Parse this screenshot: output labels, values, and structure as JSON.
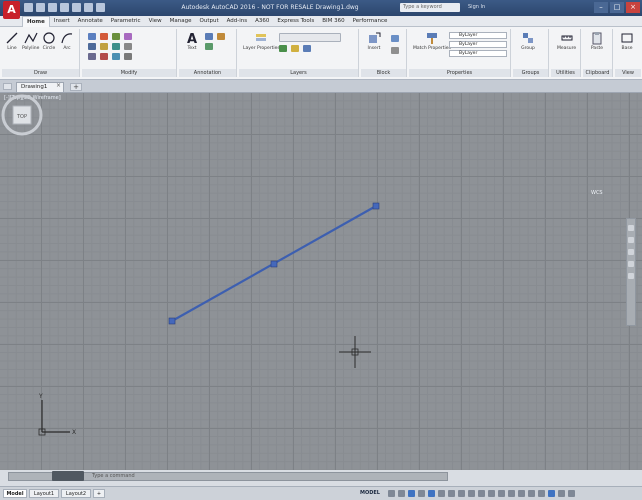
{
  "app": {
    "letter": "A",
    "title": "Autodesk AutoCAD 2016 - NOT FOR RESALE  Drawing1.dwg",
    "search_placeholder": "Type a keyword",
    "sign_in": "Sign In"
  },
  "ribbon": {
    "tabs": [
      "Home",
      "Insert",
      "Annotate",
      "Parametric",
      "View",
      "Manage",
      "Output",
      "Add-ins",
      "A360",
      "Express Tools",
      "BIM 360",
      "Performance"
    ],
    "active_tab": "Home",
    "panels": [
      {
        "title": "Draw",
        "tools": [
          "Line",
          "Polyline",
          "Circle",
          "Arc"
        ]
      },
      {
        "title": "Modify",
        "tools": []
      },
      {
        "title": "Annotation",
        "tools": [
          "Text"
        ]
      },
      {
        "title": "Layers",
        "tools": [
          "Layer Properties"
        ]
      },
      {
        "title": "Block",
        "tools": [
          "Insert"
        ]
      },
      {
        "title": "Properties",
        "tools": [
          "Match Properties"
        ],
        "values": [
          "ByLayer",
          "ByLayer",
          "ByLayer"
        ]
      },
      {
        "title": "Groups",
        "tools": [
          "Group"
        ]
      },
      {
        "title": "Utilities",
        "tools": [
          "Measure"
        ]
      },
      {
        "title": "Clipboard",
        "tools": [
          "Paste"
        ]
      },
      {
        "title": "View",
        "tools": [
          "Base"
        ]
      }
    ]
  },
  "file_tabs": {
    "current": "Drawing1"
  },
  "viewport": {
    "label": "[-][Top][2D Wireframe]",
    "viewcube_label": "WCS"
  },
  "command_line": {
    "placeholder": "Type a command"
  },
  "status": {
    "layout_tabs": [
      "Model",
      "Layout1",
      "Layout2"
    ],
    "active_layout": "Model",
    "model_label": "MODEL"
  },
  "colors": {
    "canvas_bg": "#8e9297",
    "line_color": "#3d5fb0",
    "title_bar": "#2c466d",
    "app_button": "#c8202a"
  }
}
